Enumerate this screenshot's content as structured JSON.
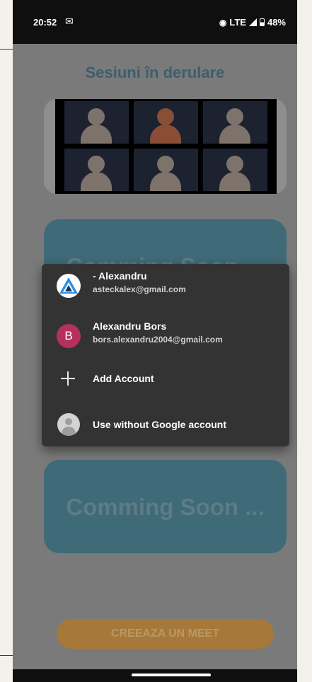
{
  "status_bar": {
    "time": "20:52",
    "mail_icon": "gmail-icon",
    "network": "LTE",
    "battery": "48%"
  },
  "page": {
    "title": "Sesiuni în derulare",
    "video_tiles": [
      {
        "color": "#7d736a"
      },
      {
        "color": "#8a4d36"
      },
      {
        "color": "#7d736a"
      },
      {
        "color": "#7d736a"
      },
      {
        "color": "#7d736a"
      },
      {
        "color": "#7d736a"
      }
    ],
    "cards": [
      {
        "label": "Comming Soon ..."
      },
      {
        "label": "Comming Soon ..."
      }
    ],
    "create_meet_label": "CREEAZA UN MEET"
  },
  "account_picker": {
    "accounts": [
      {
        "name": "- Alexandru",
        "email": "asteckalex@gmail.com",
        "avatar_icon": "triangle-logo-icon"
      },
      {
        "name": "Alexandru Bors",
        "email": "bors.alexandru2004@gmail.com",
        "avatar_letter": "B",
        "avatar_color": "#b5315b"
      }
    ],
    "add_account_label": "Add Account",
    "no_account_label": "Use without Google account"
  }
}
